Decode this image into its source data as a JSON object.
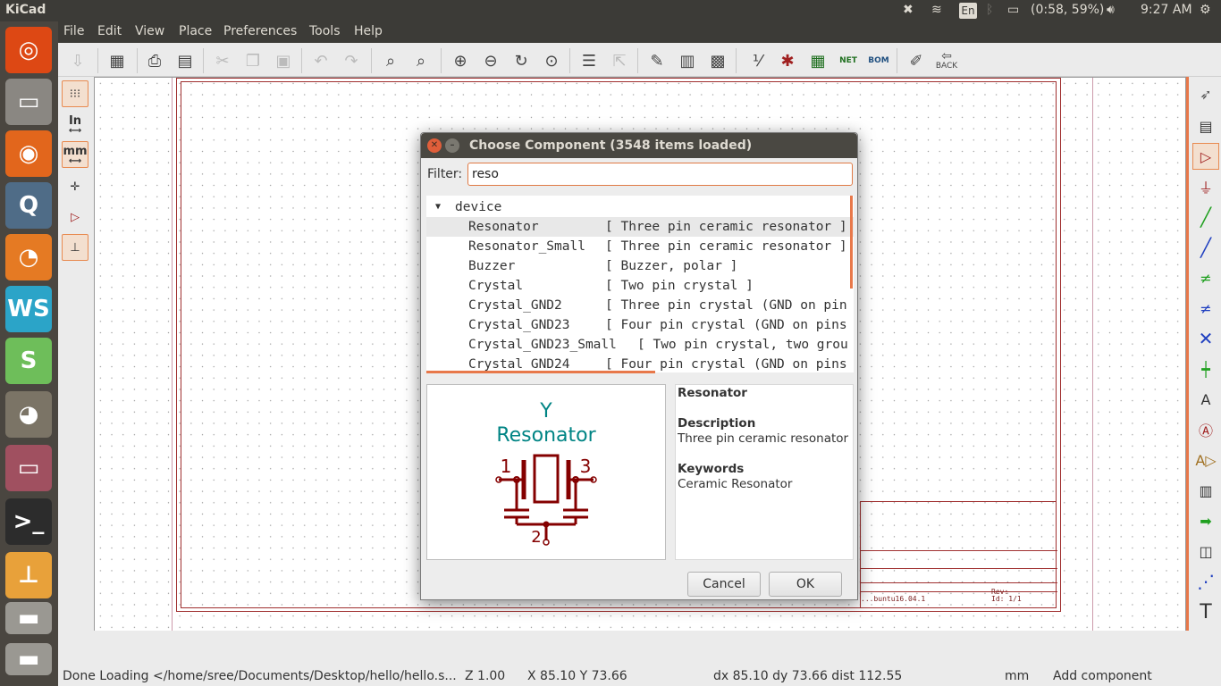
{
  "top_panel": {
    "app_title": "KiCad",
    "keyboard_lang": "En",
    "battery": "(0:58, 59%)",
    "clock": "9:27 AM"
  },
  "launcher": {
    "items": [
      {
        "name": "ubuntu-dash-icon",
        "glyph": "◎",
        "color": "#dd4814"
      },
      {
        "name": "files-icon",
        "glyph": "▭",
        "color": "#8a8782"
      },
      {
        "name": "firefox-icon",
        "glyph": "◉",
        "color": "#e2661c"
      },
      {
        "name": "qgis-icon",
        "glyph": "Q",
        "color": "#4f6c87"
      },
      {
        "name": "blender-icon",
        "glyph": "◔",
        "color": "#e57a23"
      },
      {
        "name": "webstorm-icon",
        "glyph": "WS",
        "color": "#2ba4c8"
      },
      {
        "name": "slack-icon",
        "glyph": "S",
        "color": "#6ebe5a"
      },
      {
        "name": "gimp-icon",
        "glyph": "◕",
        "color": "#7b7466"
      },
      {
        "name": "files-2-icon",
        "glyph": "▭",
        "color": "#a05060"
      },
      {
        "name": "terminal-icon",
        "glyph": ">_",
        "color": "#2c2c2c"
      },
      {
        "name": "kicad-icon",
        "glyph": "⊥",
        "color": "#e8a13a"
      },
      {
        "name": "disk-1-icon",
        "glyph": "▬",
        "color": "#9a9892"
      },
      {
        "name": "disk-2-icon",
        "glyph": "▬",
        "color": "#9a9892"
      }
    ]
  },
  "menubar": {
    "items": [
      "File",
      "Edit",
      "View",
      "Place",
      "Preferences",
      "Tools",
      "Help"
    ]
  },
  "toolbar": {
    "back_label": "BACK",
    "net_label": "NET",
    "bom_label": "BOM"
  },
  "left_toolbar": {
    "inch_label": "In",
    "mm_label": "mm"
  },
  "title_block": {
    "rev_label": "Rev:",
    "id_label": "Id: 1/1",
    "kicad_version": "...buntu16.04.1"
  },
  "status": {
    "message": "Done Loading </home/sree/Documents/Desktop/hello/hello.s...",
    "zoom": "Z 1.00",
    "xy": "X 85.10  Y 73.66",
    "delta": "dx 85.10  dy 73.66  dist 112.55",
    "units": "mm",
    "mode": "Add component"
  },
  "dialog": {
    "title": "Choose Component (3548 items loaded)",
    "filter_label": "Filter:",
    "filter_value": "reso",
    "group": "device",
    "items": [
      {
        "name": "Resonator",
        "desc": "[ Three pin ceramic resonator ]",
        "selected": true
      },
      {
        "name": "Resonator_Small",
        "desc": "[ Three pin ceramic resonator ]",
        "selected": false
      },
      {
        "name": "Buzzer",
        "desc": "[ Buzzer, polar ]",
        "selected": false
      },
      {
        "name": "Crystal",
        "desc": "[ Two pin crystal ]",
        "selected": false
      },
      {
        "name": "Crystal_GND2",
        "desc": "[ Three pin crystal (GND on pin",
        "selected": false
      },
      {
        "name": "Crystal_GND23",
        "desc": "[ Four pin crystal (GND on pins",
        "selected": false
      },
      {
        "name": "Crystal_GND23_Small",
        "desc": "[ Two pin crystal, two grou",
        "selected": false
      },
      {
        "name": "Crystal_GND24",
        "desc": "[ Four pin crystal (GND on pins",
        "selected": false
      }
    ],
    "preview": {
      "ref": "Y",
      "value": "Resonator",
      "pin1": "1",
      "pin3": "3",
      "pin2": "2",
      "ref_color": "#008484",
      "symbol_color": "#840000"
    },
    "info": {
      "name": "Resonator",
      "description_label": "Description",
      "description": "Three pin ceramic resonator",
      "keywords_label": "Keywords",
      "keywords": "Ceramic Resonator"
    },
    "cancel_label": "Cancel",
    "ok_label": "OK"
  }
}
